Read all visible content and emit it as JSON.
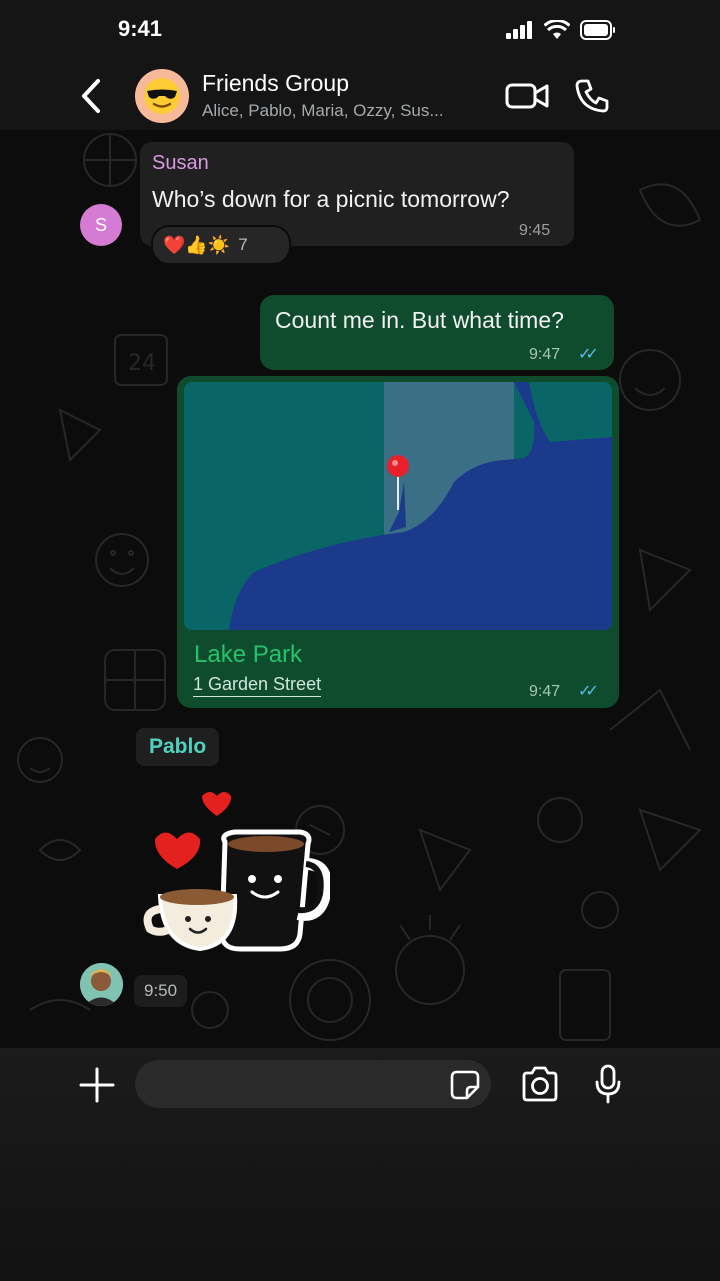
{
  "status": {
    "time": "9:41"
  },
  "header": {
    "title": "Friends Group",
    "subtitle": "Alice, Pablo, Maria, Ozzy, Sus...",
    "avatar_emoji": "😎"
  },
  "messages": {
    "susan": {
      "sender": "Susan",
      "avatar_initial": "S",
      "text": "Who’s down for a picnic tomorrow?",
      "time": "9:45",
      "reactions": "❤️👍☀️",
      "reaction_count": "7"
    },
    "reply": {
      "text": "Count me in. But what time?",
      "time": "9:47",
      "ticks": "✓✓"
    },
    "location": {
      "name": "Lake Park",
      "address": "1 Garden Street",
      "time": "9:47",
      "ticks": "✓✓"
    },
    "pablo": {
      "sender": "Pablo",
      "time": "9:50"
    }
  },
  "composer": {
    "placeholder": ""
  },
  "colors": {
    "outgoing_bubble": "#0f4c2e",
    "incoming_bubble": "#202020",
    "read_ticks": "#53bdeb",
    "location_name": "#25c26b",
    "pablo_name": "#4fd1c0",
    "susan_name": "#d99be0"
  },
  "icons": [
    "back-chevron-icon",
    "video-call-icon",
    "phone-icon",
    "plus-icon",
    "sticker-icon",
    "camera-icon",
    "microphone-icon",
    "location-pin-icon"
  ]
}
